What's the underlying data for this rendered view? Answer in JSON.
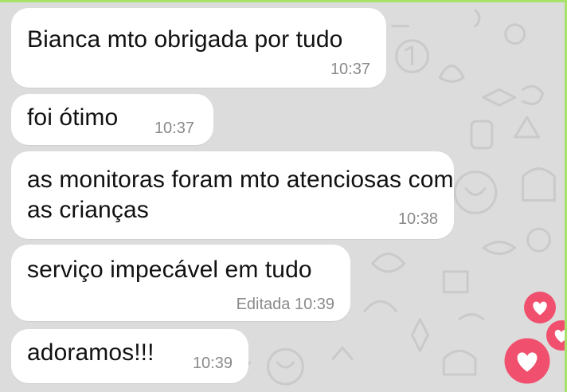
{
  "chat": {
    "background_color": "#dcdcdc",
    "accent_border_color": "#a8e26a",
    "messages": [
      {
        "text": "Bianca mto obrigada por tudo",
        "time": "10:37"
      },
      {
        "text": "foi ótimo",
        "time": "10:37"
      },
      {
        "text": "as monitoras foram mto atenciosas com as crianças",
        "time": "10:38"
      },
      {
        "text": "serviço impecável em tudo",
        "time": "Editada 10:39"
      },
      {
        "text": "adoramos!!!",
        "time": "10:39"
      }
    ]
  },
  "decorations": {
    "hearts": [
      "heart-icon",
      "heart-icon",
      "heart-icon"
    ],
    "heart_color": "#f0506e"
  }
}
